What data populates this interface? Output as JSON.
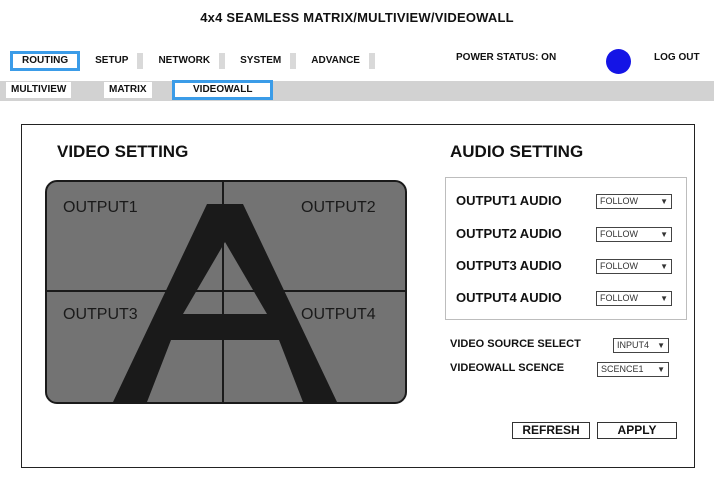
{
  "header": {
    "title": "4x4 SEAMLESS MATRIX/MULTIVIEW/VIDEOWALL"
  },
  "nav": {
    "tabs": [
      {
        "label": "ROUTING",
        "active": true
      },
      {
        "label": "SETUP",
        "active": false
      },
      {
        "label": "NETWORK",
        "active": false
      },
      {
        "label": "SYSTEM",
        "active": false
      },
      {
        "label": "ADVANCE",
        "active": false
      }
    ],
    "power_status": "POWER STATUS: ON",
    "power_color": "#1414e6",
    "logout": "LOG OUT"
  },
  "subnav": {
    "tabs": [
      {
        "label": "MULTIVIEW",
        "active": false
      },
      {
        "label": "MATRIX",
        "active": false
      },
      {
        "label": "VIDEOWALL",
        "active": true
      }
    ]
  },
  "video": {
    "heading": "VIDEO SETTING",
    "outputs": [
      "OUTPUT1",
      "OUTPUT2",
      "OUTPUT3",
      "OUTPUT4"
    ],
    "source_letter": "A"
  },
  "audio": {
    "heading": "AUDIO SETTING",
    "rows": [
      {
        "label": "OUTPUT1 AUDIO",
        "value": "FOLLOW"
      },
      {
        "label": "OUTPUT2 AUDIO",
        "value": "FOLLOW"
      },
      {
        "label": "OUTPUT3 AUDIO",
        "value": "FOLLOW"
      },
      {
        "label": "OUTPUT4 AUDIO",
        "value": "FOLLOW"
      }
    ]
  },
  "controls": {
    "video_source_label": "VIDEO SOURCE SELECT",
    "video_source_value": "INPUT4",
    "scene_label": "VIDEOWALL SCENCE",
    "scene_value": "SCENCE1",
    "refresh": "REFRESH",
    "apply": "APPLY"
  },
  "colors": {
    "accent": "#3b9ce8",
    "wall_fill": "#737373",
    "subbar": "#d2d2d2"
  }
}
